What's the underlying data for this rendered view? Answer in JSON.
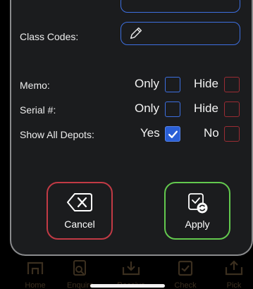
{
  "filters": {
    "class_codes_label": "Class Codes:",
    "memo_label": "Memo:",
    "serial_label": "Serial #:",
    "depots_label": "Show All Depots:",
    "only_label": "Only",
    "hide_label": "Hide",
    "yes_label": "Yes",
    "no_label": "No",
    "memo": {
      "only": false,
      "hide": false
    },
    "serial": {
      "only": false,
      "hide": false
    },
    "depots": {
      "yes": true,
      "no": false
    }
  },
  "actions": {
    "cancel_label": "Cancel",
    "apply_label": "Apply"
  },
  "tabbar": {
    "items": [
      {
        "label": "Home",
        "icon": "home-icon"
      },
      {
        "label": "Enquire",
        "icon": "enquire-icon"
      },
      {
        "label": "Receive",
        "icon": "receive-icon"
      },
      {
        "label": "Check",
        "icon": "check-icon"
      },
      {
        "label": "Pick",
        "icon": "pick-icon"
      }
    ]
  },
  "colors": {
    "accent_blue": "#3d6fe0",
    "cancel_red": "#c23a45",
    "apply_green": "#63c94e",
    "hide_red": "#9b2c33"
  }
}
